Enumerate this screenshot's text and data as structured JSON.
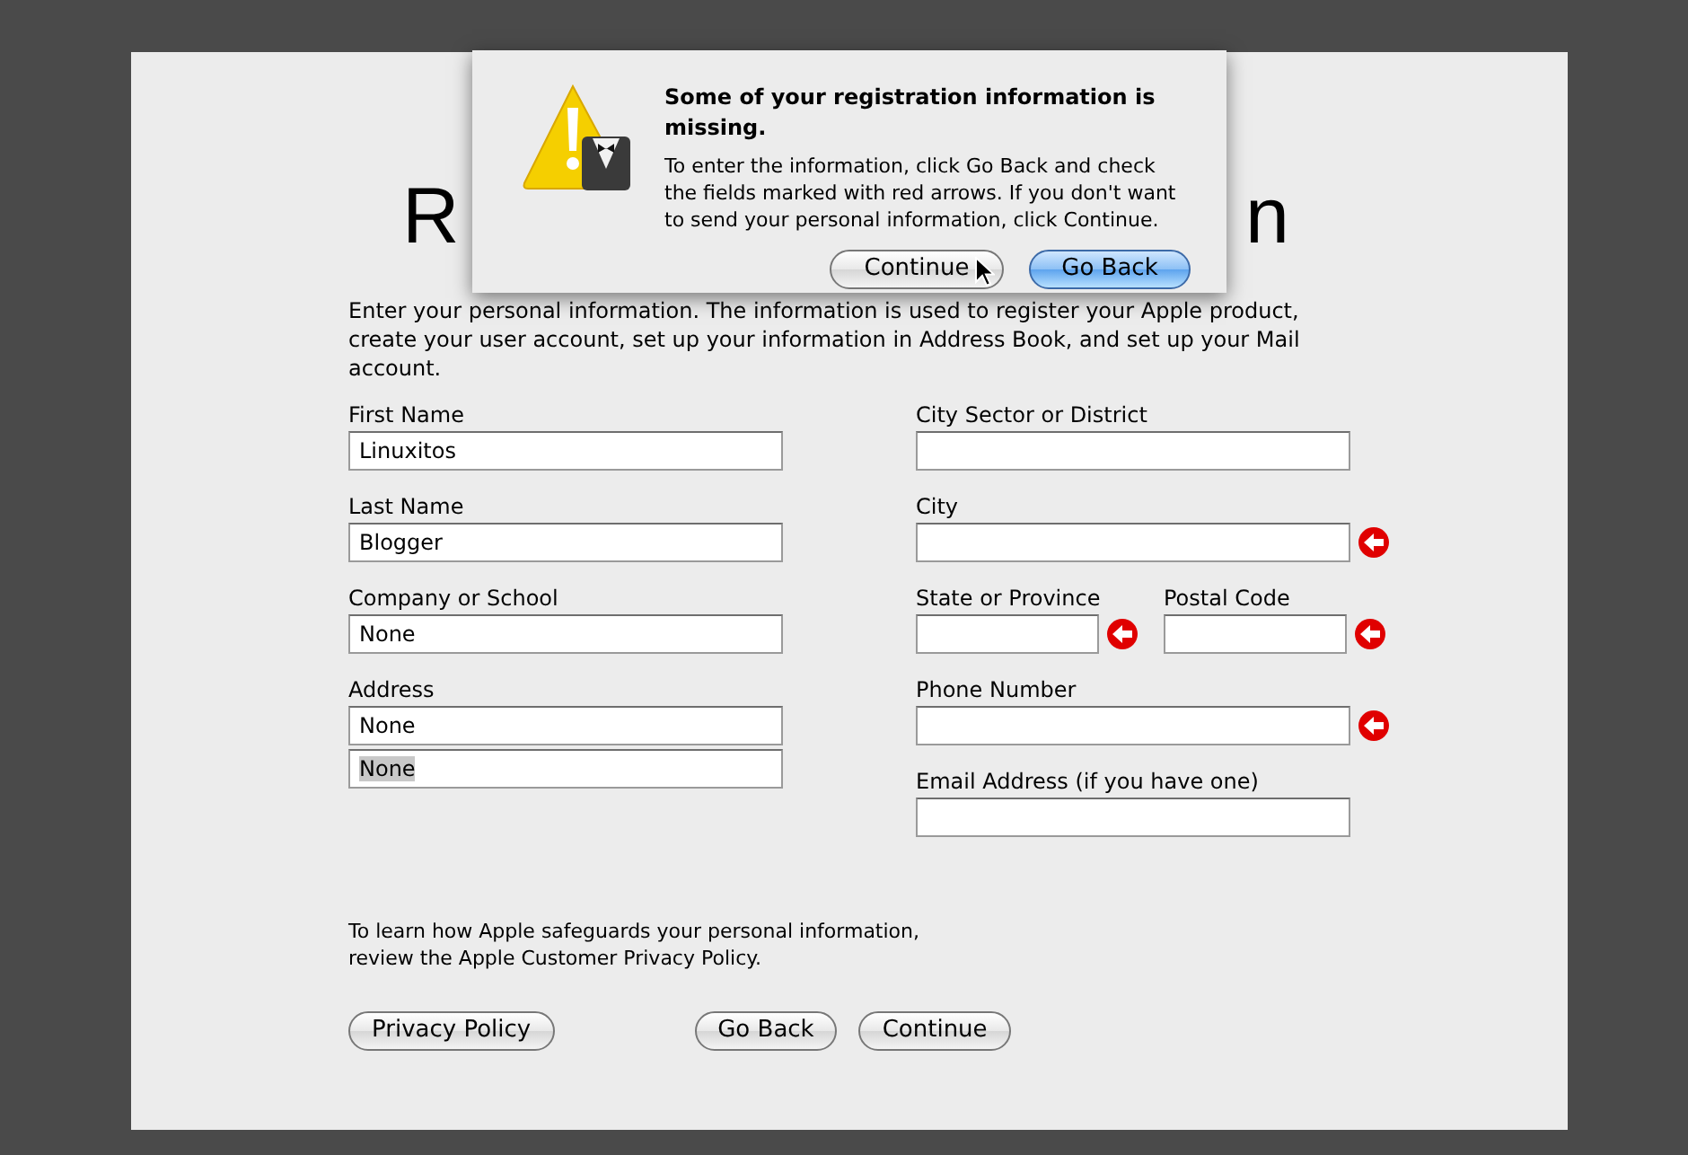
{
  "page": {
    "title_visible_parts": [
      "R",
      "n"
    ],
    "intro": "Enter your personal information. The information is used to register your Apple product, create your user account, set up your information in Address Book, and set up your Mail account.",
    "left_fields": [
      {
        "label": "First Name",
        "lines": [
          {
            "value": "Linuxitos",
            "selected": false
          }
        ],
        "missing": false
      },
      {
        "label": "Last Name",
        "lines": [
          {
            "value": "Blogger",
            "selected": false
          }
        ],
        "missing": false
      },
      {
        "label": "Company or School",
        "lines": [
          {
            "value": "None",
            "selected": false
          }
        ],
        "missing": false
      },
      {
        "label": "Address",
        "lines": [
          {
            "value": "None",
            "selected": false
          },
          {
            "value": "None",
            "selected": true
          }
        ],
        "missing": false
      }
    ],
    "right_rows": [
      [
        {
          "label": "City Sector or District",
          "missing": false
        }
      ],
      [
        {
          "label": "City",
          "missing": true
        }
      ],
      [
        {
          "label": "State or Province",
          "missing": true
        },
        {
          "label": "Postal Code",
          "missing": true
        }
      ],
      [
        {
          "label": "Phone Number",
          "missing": true
        }
      ],
      [
        {
          "label": "Email Address (if you have one)",
          "missing": false
        }
      ]
    ],
    "privacy_note": "To learn how Apple safeguards your personal information, review the Apple Customer Privacy Policy.",
    "privacy_button": "Privacy Policy",
    "buttons": [
      "Go Back",
      "Continue"
    ]
  },
  "dialog": {
    "title": "Some of your registration information is missing.",
    "message": "To enter the information, click Go Back and check the fields marked with red arrows. If you don't want to send your personal information, click Continue.",
    "buttons": [
      {
        "label": "Continue",
        "default": false
      },
      {
        "label": "Go Back",
        "default": true
      }
    ]
  }
}
